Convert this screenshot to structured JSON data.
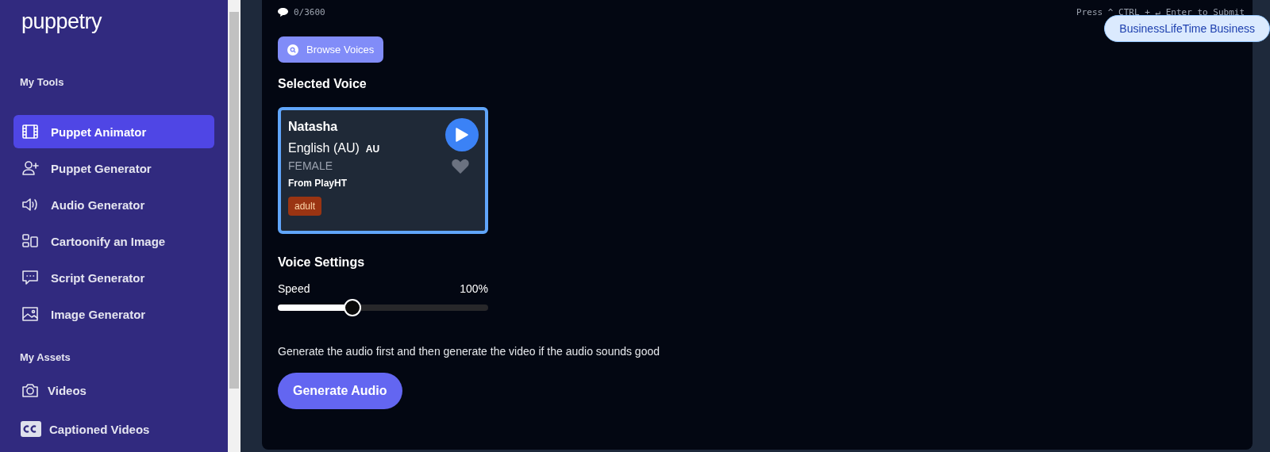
{
  "sidebar": {
    "logo": "puppetry",
    "sections": [
      {
        "title": "My Tools",
        "items": [
          {
            "label": "Puppet Animator",
            "selected": true
          },
          {
            "label": "Puppet Generator",
            "selected": false
          },
          {
            "label": "Audio Generator",
            "selected": false
          },
          {
            "label": "Cartoonify an Image",
            "selected": false
          },
          {
            "label": "Script Generator",
            "selected": false
          },
          {
            "label": "Image Generator",
            "selected": false
          }
        ]
      },
      {
        "title": "My Assets",
        "items": [
          {
            "label": "Videos",
            "selected": false
          },
          {
            "label": "Captioned Videos",
            "selected": false
          }
        ]
      }
    ]
  },
  "editor": {
    "char_count": "0/3600",
    "submit_hint": "Press ^ CTRL + ↵ Enter to Submit"
  },
  "plan_badge": "BusinessLifeTime Business",
  "browse_button": "Browse Voices",
  "selected_voice": {
    "heading": "Selected Voice",
    "name": "Natasha",
    "language": "English (AU)",
    "accent": "AU",
    "gender": "FEMALE",
    "source": "From PlayHT",
    "tags": [
      {
        "label": "adult",
        "color": "#9a3412"
      }
    ],
    "favorite": false
  },
  "voice_settings": {
    "heading": "Voice Settings",
    "speed": {
      "label": "Speed",
      "reading": "100%",
      "level": 0.35
    }
  },
  "note": "Generate the audio first and then generate the video if the audio sounds good",
  "generate_button": "Generate Audio"
}
